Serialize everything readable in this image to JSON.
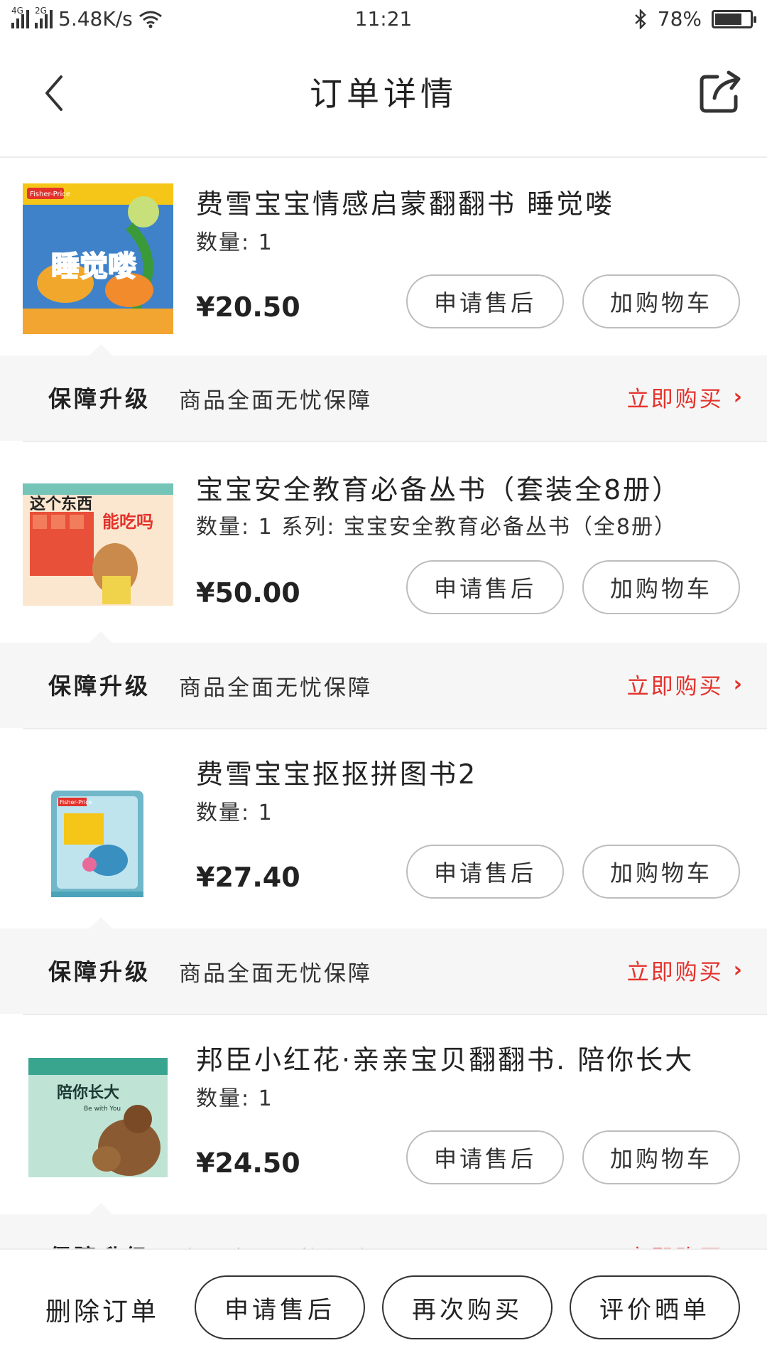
{
  "status_bar": {
    "network_1": "4G",
    "network_2": "2G",
    "speed": "5.48K/s",
    "time": "11:21",
    "battery": "78%",
    "battery_level": 0.78
  },
  "header": {
    "title": "订单详情"
  },
  "items": [
    {
      "name": "费雪宝宝情感启蒙翻翻书 睡觉喽",
      "qty": "数量: 1",
      "price": "¥20.50",
      "after_sale": "申请售后",
      "add_cart": "加购物车",
      "cover_text": "睡觉喽",
      "cover_brand": "Fisher-Price",
      "guarantee_title": "保障升级",
      "guarantee_desc": "商品全面无忧保障",
      "guarantee_buy": "立即购买"
    },
    {
      "name": "宝宝安全教育必备丛书（套装全8册）",
      "qty": "数量: 1 系列: 宝宝安全教育必备丛书（全8册）",
      "price": "¥50.00",
      "after_sale": "申请售后",
      "add_cart": "加购物车",
      "cover_text": "这个东西",
      "cover_text2": "能吃吗",
      "guarantee_title": "保障升级",
      "guarantee_desc": "商品全面无忧保障",
      "guarantee_buy": "立即购买"
    },
    {
      "name": "费雪宝宝抠抠拼图书2",
      "qty": "数量: 1",
      "price": "¥27.40",
      "after_sale": "申请售后",
      "add_cart": "加购物车",
      "cover_brand": "Fisher-Price",
      "guarantee_title": "保障升级",
      "guarantee_desc": "商品全面无忧保障",
      "guarantee_buy": "立即购买"
    },
    {
      "name": "邦臣小红花·亲亲宝贝翻翻书. 陪你长大",
      "qty": "数量: 1",
      "price": "¥24.50",
      "after_sale": "申请售后",
      "add_cart": "加购物车",
      "cover_text": "陪你长大",
      "cover_sub": "Be with You",
      "guarantee_title": "保障升级",
      "guarantee_desc": "商品全面无忧保障",
      "guarantee_buy": "立即购买"
    }
  ],
  "bottom_bar": {
    "delete": "删除订单",
    "after_sale": "申请售后",
    "rebuy": "再次购买",
    "review": "评价晒单"
  },
  "colors": {
    "accent_red": "#e4322b",
    "guarantee_bg": "#f6f6f6"
  }
}
